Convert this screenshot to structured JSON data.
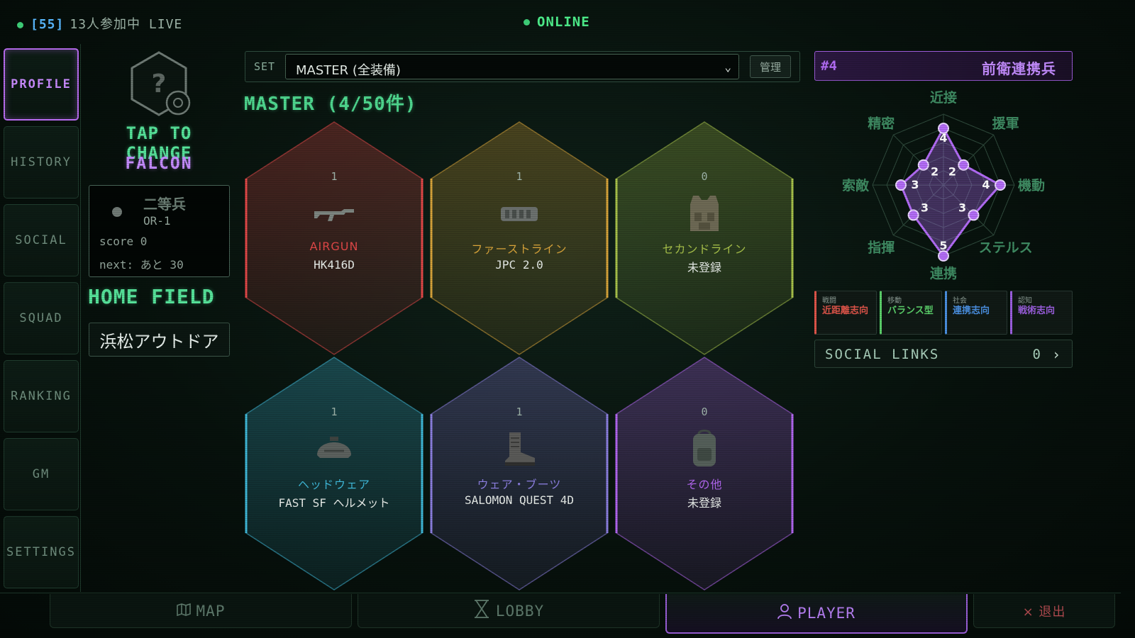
{
  "status": {
    "room_id": "[55]",
    "participants": "13人参加中",
    "live_label": "LIVE",
    "online_label": "ONLINE"
  },
  "sidenav": {
    "items": [
      {
        "label": "PROFILE",
        "active": true
      },
      {
        "label": "HISTORY"
      },
      {
        "label": "SOCIAL"
      },
      {
        "label": "SQUAD"
      },
      {
        "label": "RANKING"
      },
      {
        "label": "GM"
      },
      {
        "label": "SETTINGS"
      }
    ]
  },
  "profile": {
    "avatar_placeholder": "?",
    "tap_to_change": "TAP TO CHANGE",
    "callsign": "FALCON",
    "rank_name": "二等兵",
    "rank_code": "OR-1",
    "score": "score 0",
    "next": "next: あと 30",
    "home_field_title": "HOME FIELD",
    "home_field": "浜松アウトドア"
  },
  "loadout": {
    "set_label": "SET",
    "selected_set": "MASTER (全装備)",
    "manage_label": "管理",
    "title": "MASTER (4/50件)",
    "cards": [
      {
        "count": "1",
        "category": "AIRGUN",
        "item": "HK416D",
        "icon": "rifle-icon",
        "color": "#e24848"
      },
      {
        "count": "1",
        "category": "ファーストライン",
        "item": "JPC 2.0",
        "icon": "plate-carrier-icon",
        "color": "#d8a43a"
      },
      {
        "count": "0",
        "category": "セカンドライン",
        "item": "未登録",
        "icon": "vest-icon",
        "color": "#a8c24a"
      },
      {
        "count": "1",
        "category": "ヘッドウェア",
        "item": "FAST SF ヘルメット",
        "icon": "helmet-icon",
        "color": "#3fb8d8"
      },
      {
        "count": "1",
        "category": "ウェア・ブーツ",
        "item": "SALOMON QUEST 4D",
        "icon": "boot-icon",
        "color": "#8c7fe0"
      },
      {
        "count": "0",
        "category": "その他",
        "item": "未登録",
        "icon": "backpack-icon",
        "color": "#b266f0"
      }
    ]
  },
  "player_title": {
    "number": "#4",
    "title": "前衛連携兵"
  },
  "radar": {
    "axes": [
      "近接",
      "援軍",
      "機動",
      "ステルス",
      "連携",
      "指揮",
      "索敵",
      "精密"
    ],
    "values": [
      4,
      2,
      4,
      3,
      5,
      3,
      3,
      2
    ],
    "max": 5,
    "color": "#b36cf6"
  },
  "tags": [
    {
      "category": "戦闘",
      "value": "近距離志向",
      "color": "#e0554a"
    },
    {
      "category": "移動",
      "value": "バランス型",
      "color": "#5bd06a"
    },
    {
      "category": "社会",
      "value": "連携志向",
      "color": "#4a8fe0"
    },
    {
      "category": "認知",
      "value": "戦術志向",
      "color": "#9c5fe0"
    }
  ],
  "social_links": {
    "label": "SOCIAL LINKS",
    "count": "0",
    "arrow": "›"
  },
  "bottomnav": {
    "map": "MAP",
    "lobby": "LOBBY",
    "player": "PLAYER",
    "exit": "× 退出"
  }
}
